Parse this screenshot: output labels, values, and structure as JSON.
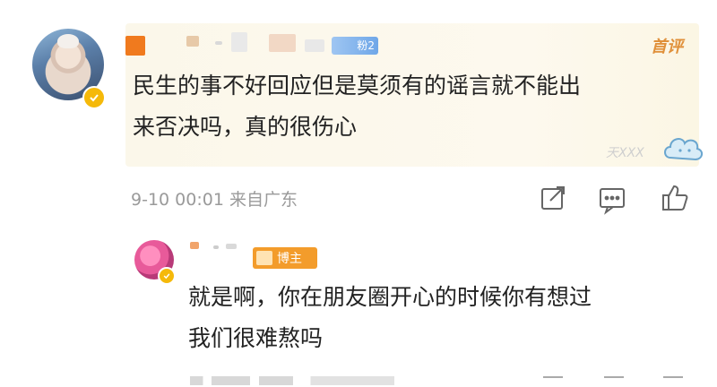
{
  "main_comment": {
    "badge_text": "粉2",
    "tag": "首评",
    "text_line1": "民生的事不好回应但是莫须有的谣言就不能出",
    "text_line2": "来否决吗，真的很伤心",
    "meta": "9-10 00:01 来自广东",
    "watermark": "天XXX"
  },
  "reply": {
    "role_tag": "博主",
    "text_line1": "就是啊，你在朋友圈开心的时候你有想过",
    "text_line2": "我们很难熬吗"
  },
  "icons": [
    "share-icon",
    "comment-icon",
    "like-icon",
    "verified-badge-icon"
  ],
  "colors": {
    "accent_orange": "#f39c2b",
    "badge_yellow": "#f5b90a",
    "meta_gray": "#9a9a9a",
    "text_dark": "#222222"
  }
}
